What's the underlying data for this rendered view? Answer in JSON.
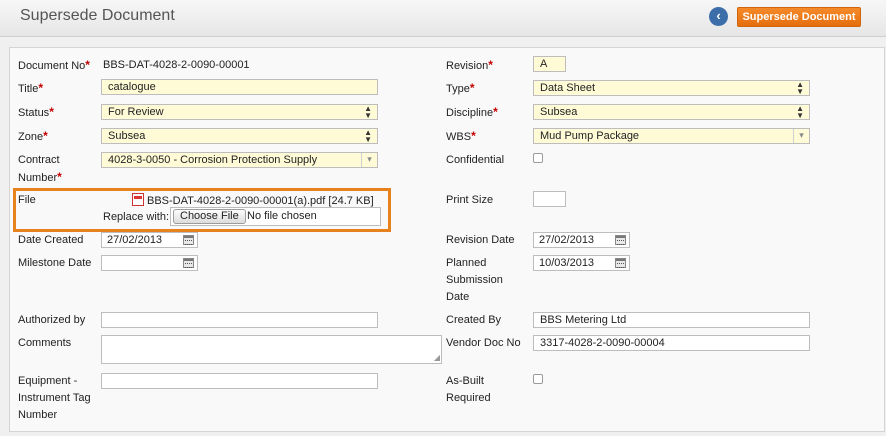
{
  "header": {
    "title": "Supersede Document",
    "back_icon": "chevron-left-icon",
    "action_button": "Supersede Document"
  },
  "form": {
    "document_no": {
      "label": "Document No",
      "value": "BBS-DAT-4028-2-0090-00001"
    },
    "revision": {
      "label": "Revision",
      "value": "A"
    },
    "title": {
      "label": "Title",
      "value": "catalogue"
    },
    "type": {
      "label": "Type",
      "value": "Data Sheet"
    },
    "status": {
      "label": "Status",
      "value": "For Review"
    },
    "discipline": {
      "label": "Discipline",
      "value": "Subsea"
    },
    "zone": {
      "label": "Zone",
      "value": "Subsea"
    },
    "wbs": {
      "label": "WBS",
      "value": "Mud Pump Package"
    },
    "contract_number": {
      "label_line1": "Contract",
      "label_line2": "Number",
      "value": "4028-3-0050 - Corrosion Protection Supply"
    },
    "confidential": {
      "label": "Confidential",
      "checked": false
    },
    "file": {
      "label": "File",
      "current_file": "BBS-DAT-4028-2-0090-00001(a).pdf [24.7 KB]",
      "replace_label": "Replace with:",
      "choose_button": "Choose File",
      "no_file_text": "No file chosen"
    },
    "print_size": {
      "label": "Print Size",
      "value": ""
    },
    "date_created": {
      "label": "Date Created",
      "value": "27/02/2013"
    },
    "revision_date": {
      "label": "Revision Date",
      "value": "27/02/2013"
    },
    "milestone_date": {
      "label": "Milestone Date",
      "value": ""
    },
    "planned_submission_date": {
      "label_line1": "Planned",
      "label_line2": "Submission",
      "label_line3": "Date",
      "value": "10/03/2013"
    },
    "authorized_by": {
      "label": "Authorized by",
      "value": ""
    },
    "created_by": {
      "label": "Created By",
      "value": "BBS Metering Ltd"
    },
    "comments": {
      "label": "Comments",
      "value": ""
    },
    "vendor_doc_no": {
      "label": "Vendor Doc No",
      "value": "3317-4028-2-0090-00004"
    },
    "equipment_tag": {
      "label_line1": "Equipment -",
      "label_line2": "Instrument Tag",
      "label_line3": "Number",
      "value": ""
    },
    "as_built": {
      "label_line1": "As-Built",
      "label_line2": "Required",
      "checked": false
    }
  },
  "colors": {
    "accent_orange": "#e8821e",
    "back_button_blue": "#3c6fa9",
    "required_marker": "#c40000",
    "highlight_field": "#fffbd6"
  },
  "required_marker": "*"
}
